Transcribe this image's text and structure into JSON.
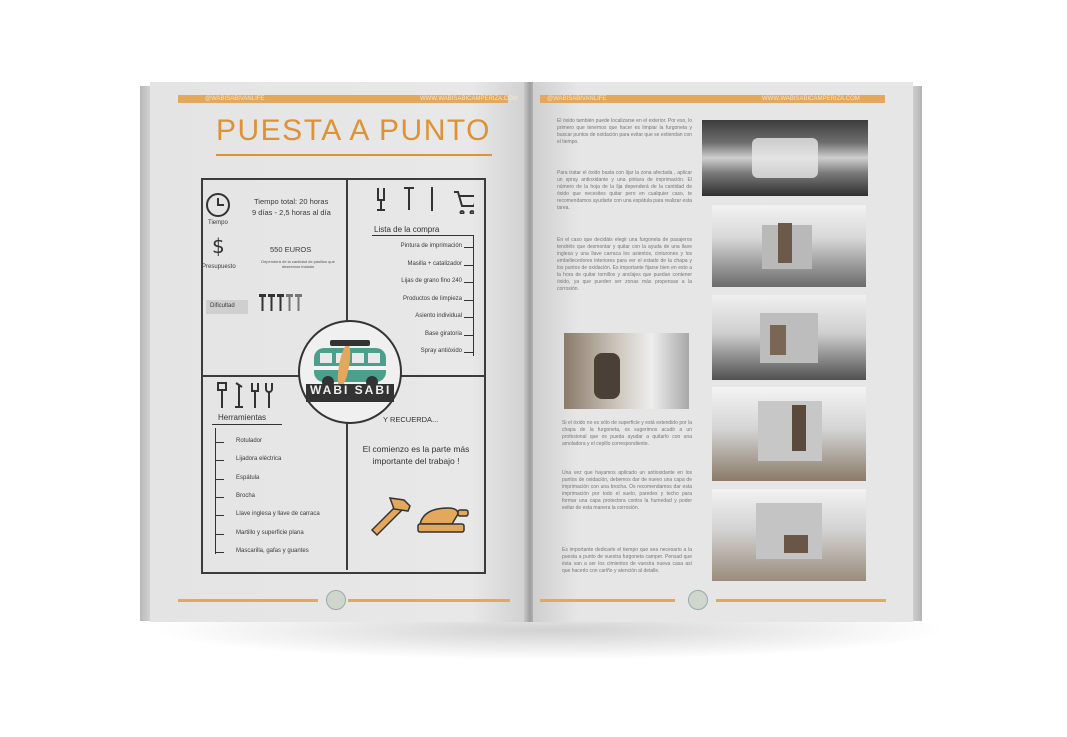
{
  "left_page": {
    "header_handle": "@WABISABIVANLIFE",
    "header_web": "WWW.WABISABICAMPERIZA.COM",
    "title": "PUESTA A PUNTO",
    "time_label": "Tiempo",
    "time_total": "Tiempo total: 20 horas",
    "time_days": "9 días - 2,5 horas al día",
    "budget_label": "Presupuesto",
    "budget_value": "550 EUROS",
    "budget_note": "Dependerá de la cantidad de pasillos que deseemos instalar",
    "difficulty_label": "Dificultad",
    "shopping_title": "Lista de la compra",
    "shopping_items": [
      "Pintura de imprimación",
      "Masilla + catalizador",
      "Lijas de grano fino 240",
      "Productos de limpieza",
      "Asiento individual",
      "Base giratoria",
      "Spray antióxido"
    ],
    "logo_text": "WABI SABI",
    "tools_title": "Herramientas",
    "tools_items": [
      "Rotulador",
      "Lijadora eléctrica",
      "Espátula",
      "Brocha",
      "Llave inglesa y llave de carraca",
      "Martillo y superficie plana",
      "Mascarilla, gafas y guantes"
    ],
    "remember_title": "Y RECUERDA...",
    "remember_text": "El comienzo es la parte más importante del trabajo !"
  },
  "right_page": {
    "header_handle": "@WABISABIVANLIFE",
    "header_web": "WWW.WABISABICAMPERIZA.COM",
    "p1": "El óxido también puede localizarse en el exterior. Por eso, lo primero que tenemos que hacer es limpiar la furgoneta y buscar puntos de oxidación para evitar que se extiendan con el tiempo.",
    "p2": "Para tratar el óxido basta con lijar la zona afectada , aplicar un spray antioxidante y una pintura de imprimación. El número de la hoja de la lija dependerá de la cantidad de óxido que necesites quitar pero en cualquier caso, te recomendamos ayudarte con una espátula para realizar esta tarea.",
    "p3": "En el caso que decidáis elegir una furgoneta de pasajeros tendréis que desmontar y quitar con la ayuda de una llave inglesa y una llave carraca los asientos, cinturones y los embellecedores interiores para ver el estado de la chapa y los puntos de oxidación. Es importante fijarse bien en esto a la hora de quitar tornillos y anclajes que puedan contener óxido, ya que pueden ser zonas más propensas a la corrosión.",
    "p4": "Si el óxido no es sólo de superficie y está extendido por la chapa de la furgoneta, os sugerimos acudir a un profesional que os pueda ayudar a quitarlo con una amoladora y el cepillo correspondiente.",
    "p5": "Una vez que hayamos aplicado un antioxidante en los puntos de oxidación, debemos dar de nuevo una capa de imprimación con una brocha. Os recomendamos dar esta imprimación por todo el suelo, paredes y techo para formar una capa protectora contra la humedad y poder evitar de esta manera la corrosión.",
    "p6": "Es importante dedicarle el tiempo que sea necesario a la puesta a punto de vuestra furgoneta camper. Pensad que ésta van a ser los cimientos de vuestra nueva casa así que hacerlo con cariño y atención al detalle."
  },
  "colors": {
    "accent": "#dc9235",
    "bar": "#e3a85c",
    "ink": "#3c3c3c",
    "van": "#4aa08a"
  }
}
